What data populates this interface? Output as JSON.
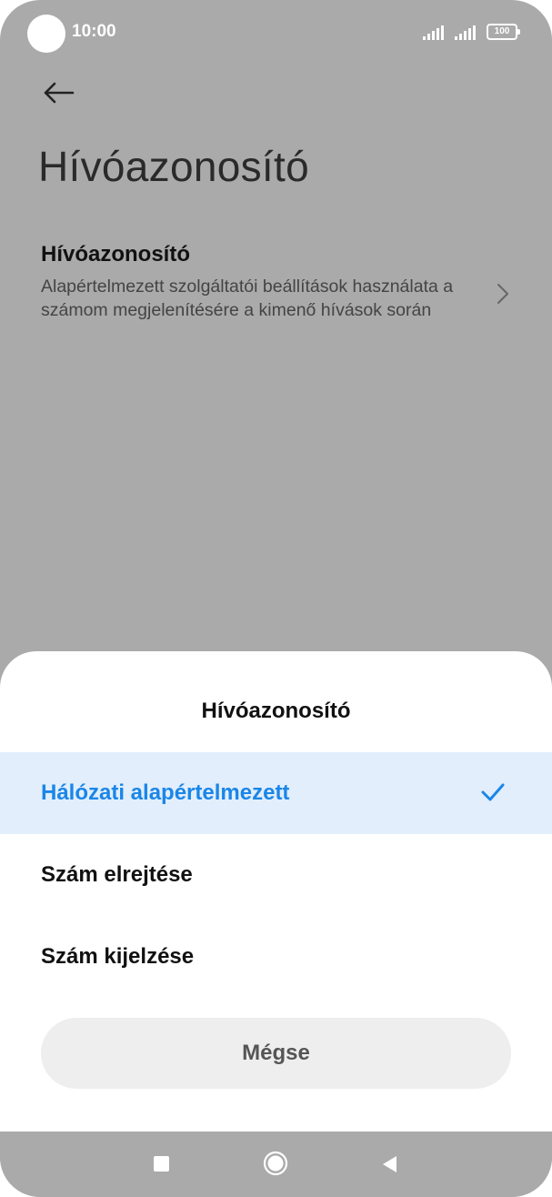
{
  "status_bar": {
    "time": "10:00",
    "battery": "100",
    "icons": [
      "signal-icon",
      "signal-icon",
      "battery-icon"
    ]
  },
  "header": {
    "back_icon": "arrow-left-icon",
    "title": "Hívóazonosító"
  },
  "setting": {
    "title": "Hívóazonosító",
    "description": "Alapértelmezett szolgáltatói beállítások használata a számom megjelenítésére a kimenő hívások során",
    "chevron_icon": "chevron-right-icon"
  },
  "dialog": {
    "title": "Hívóazonosító",
    "options": [
      {
        "label": "Hálózati alapértelmezett",
        "selected": true
      },
      {
        "label": "Szám elrejtése",
        "selected": false
      },
      {
        "label": "Szám kijelzése",
        "selected": false
      }
    ],
    "cancel_label": "Mégse"
  },
  "nav_bar": {
    "icons": [
      "recents-square-icon",
      "home-circle-icon",
      "back-triangle-icon"
    ]
  },
  "colors": {
    "scrim_background": "#aaaaaa",
    "accent": "#1a86e8",
    "selected_row": "#e2eefb",
    "cancel_button": "#eeeeee"
  }
}
